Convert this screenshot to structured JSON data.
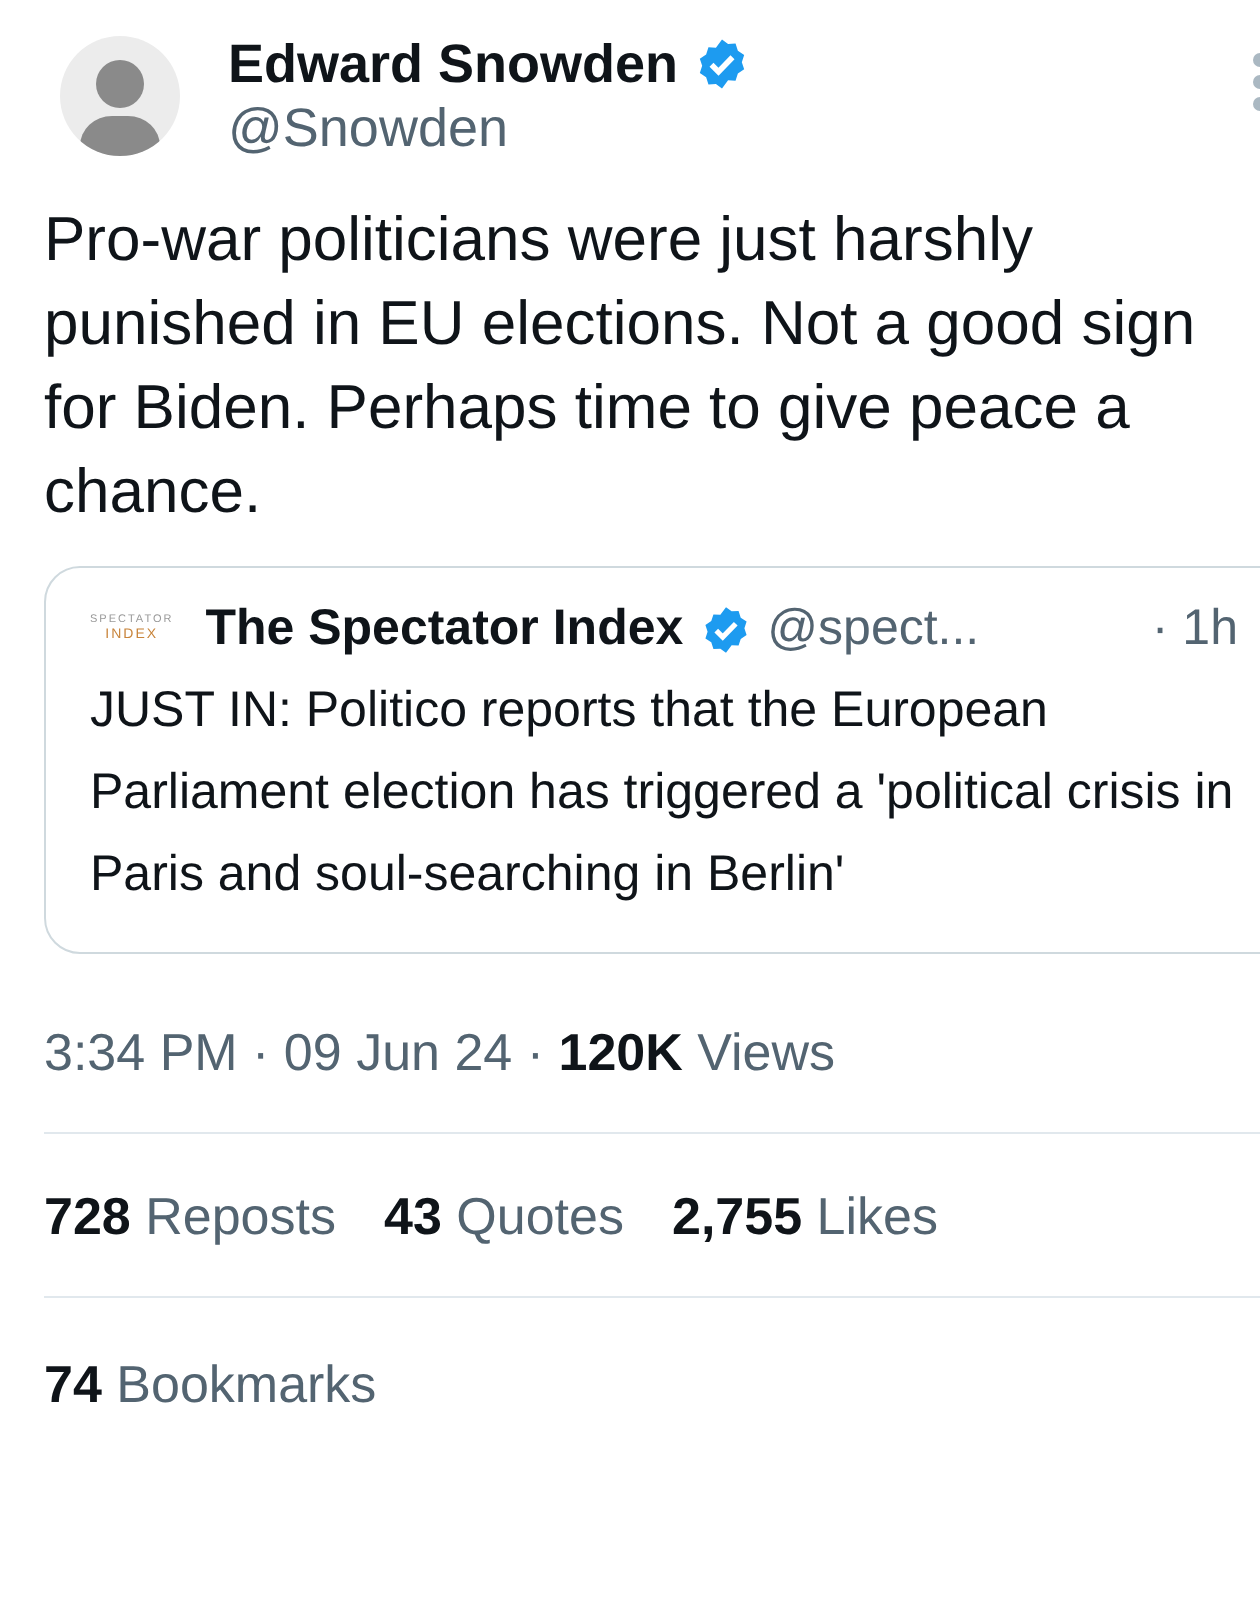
{
  "author": {
    "name": "Edward Snowden",
    "verified": true,
    "handle": "@Snowden"
  },
  "text": "Pro-war politicians were just harshly punished in EU elections. Not a good sign for Biden. Perhaps time to give peace a chance.",
  "quoted_tweet": {
    "logo_lines": [
      "SPECTATOR",
      "INDEX"
    ],
    "name": "The Spectator Index",
    "verified": true,
    "handle": "@spect...",
    "time": "· 1h",
    "text": "JUST IN: Politico reports that the European Parliament election has triggered a 'political crisis in Paris and soul-searching in Berlin'"
  },
  "meta": "3:34 PM · 09 Jun 24 · **120K** Views",
  "stats": [
    "**728** Reposts",
    "**43** Quotes",
    "**2,755** Likes"
  ],
  "bookmarks": "**74** Bookmarks"
}
